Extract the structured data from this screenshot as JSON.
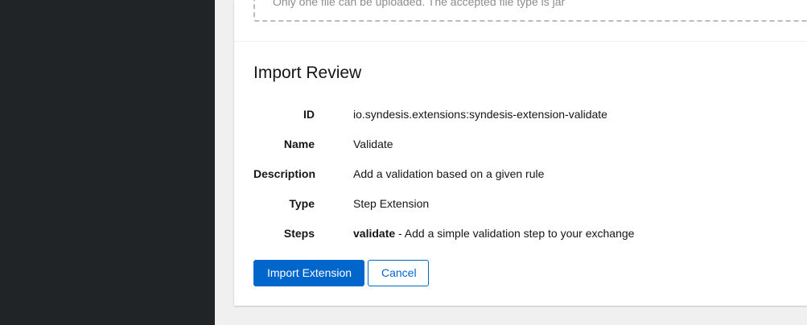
{
  "upload": {
    "hint": "Only one file can be uploaded. The accepted file type is jar"
  },
  "review": {
    "title": "Import Review",
    "rows": [
      {
        "label": "ID",
        "value": "io.syndesis.extensions:syndesis-extension-validate"
      },
      {
        "label": "Name",
        "value": "Validate"
      },
      {
        "label": "Description",
        "value": "Add a validation based on a given rule"
      },
      {
        "label": "Type",
        "value": "Step Extension"
      },
      {
        "label": "Steps",
        "step_name": "validate",
        "step_desc": " - Add a simple validation step to your exchange"
      }
    ]
  },
  "actions": {
    "import_label": "Import Extension",
    "cancel_label": "Cancel"
  },
  "colors": {
    "primary": "#0066cc",
    "sidebar": "#212427",
    "page_bg": "#f0f0f0"
  }
}
